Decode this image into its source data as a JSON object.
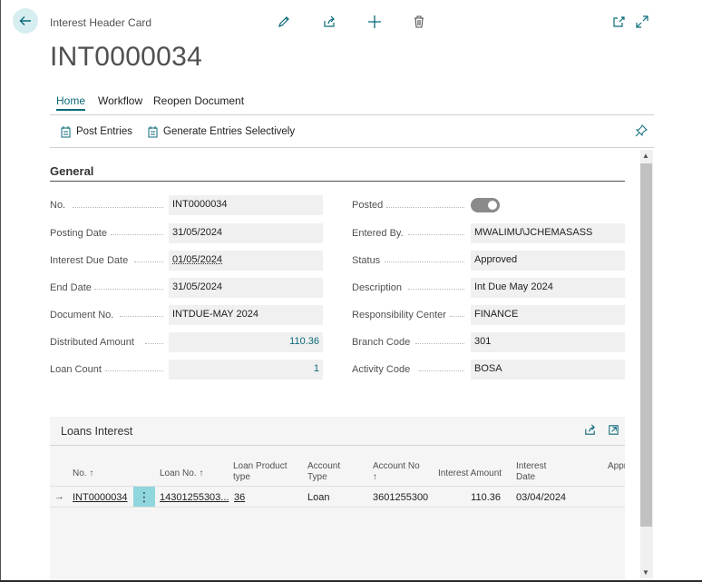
{
  "header": {
    "caption": "Interest Header Card",
    "title": "INT0000034",
    "icons": [
      "edit-icon",
      "share-icon",
      "add-icon",
      "delete-icon",
      "open-new-window-icon",
      "expand-icon"
    ]
  },
  "tabs": [
    {
      "label": "Home",
      "active": true
    },
    {
      "label": "Workflow",
      "active": false
    },
    {
      "label": "Reopen Document",
      "active": false
    }
  ],
  "actions": {
    "post_entries": "Post Entries",
    "generate_entries": "Generate Entries Selectively"
  },
  "general": {
    "title": "General",
    "left": [
      {
        "label": "No.",
        "value": "INT0000034"
      },
      {
        "label": "Posting Date",
        "value": "31/05/2024"
      },
      {
        "label": "Interest Due Date",
        "value": "01/05/2024"
      },
      {
        "label": "End Date",
        "value": "31/05/2024"
      },
      {
        "label": "Document No.",
        "value": "INTDUE-MAY 2024"
      },
      {
        "label": "Distributed Amount",
        "value": "110.36"
      },
      {
        "label": "Loan Count",
        "value": "1"
      }
    ],
    "right": [
      {
        "label": "Posted",
        "value": ""
      },
      {
        "label": "Entered By.",
        "value": "MWALIMU\\JCHEMASASS"
      },
      {
        "label": "Status",
        "value": "Approved"
      },
      {
        "label": "Description",
        "value": "Int Due May 2024"
      },
      {
        "label": "Responsibility Center",
        "value": "FINANCE"
      },
      {
        "label": "Branch Code",
        "value": "301"
      },
      {
        "label": "Activity Code",
        "value": "BOSA"
      }
    ]
  },
  "loans_interest": {
    "title": "Loans Interest",
    "columns": [
      "No.",
      "Loan No.",
      "Loan Product type",
      "Account Type",
      "Account No",
      "Interest Amount",
      "Interest Date",
      "Appr Am"
    ],
    "rows": [
      {
        "no": "INT0000034",
        "loan_no": "14301255303...",
        "loan_product_type": "36",
        "account_type": "Loan",
        "account_no": "3601255300",
        "interest_amount": "110.36",
        "interest_date": "03/04/2024"
      }
    ]
  },
  "colors": {
    "accent": "#0b6a79",
    "field_bg": "#f0f0f0",
    "kebab_bg": "#8fd6dd"
  }
}
